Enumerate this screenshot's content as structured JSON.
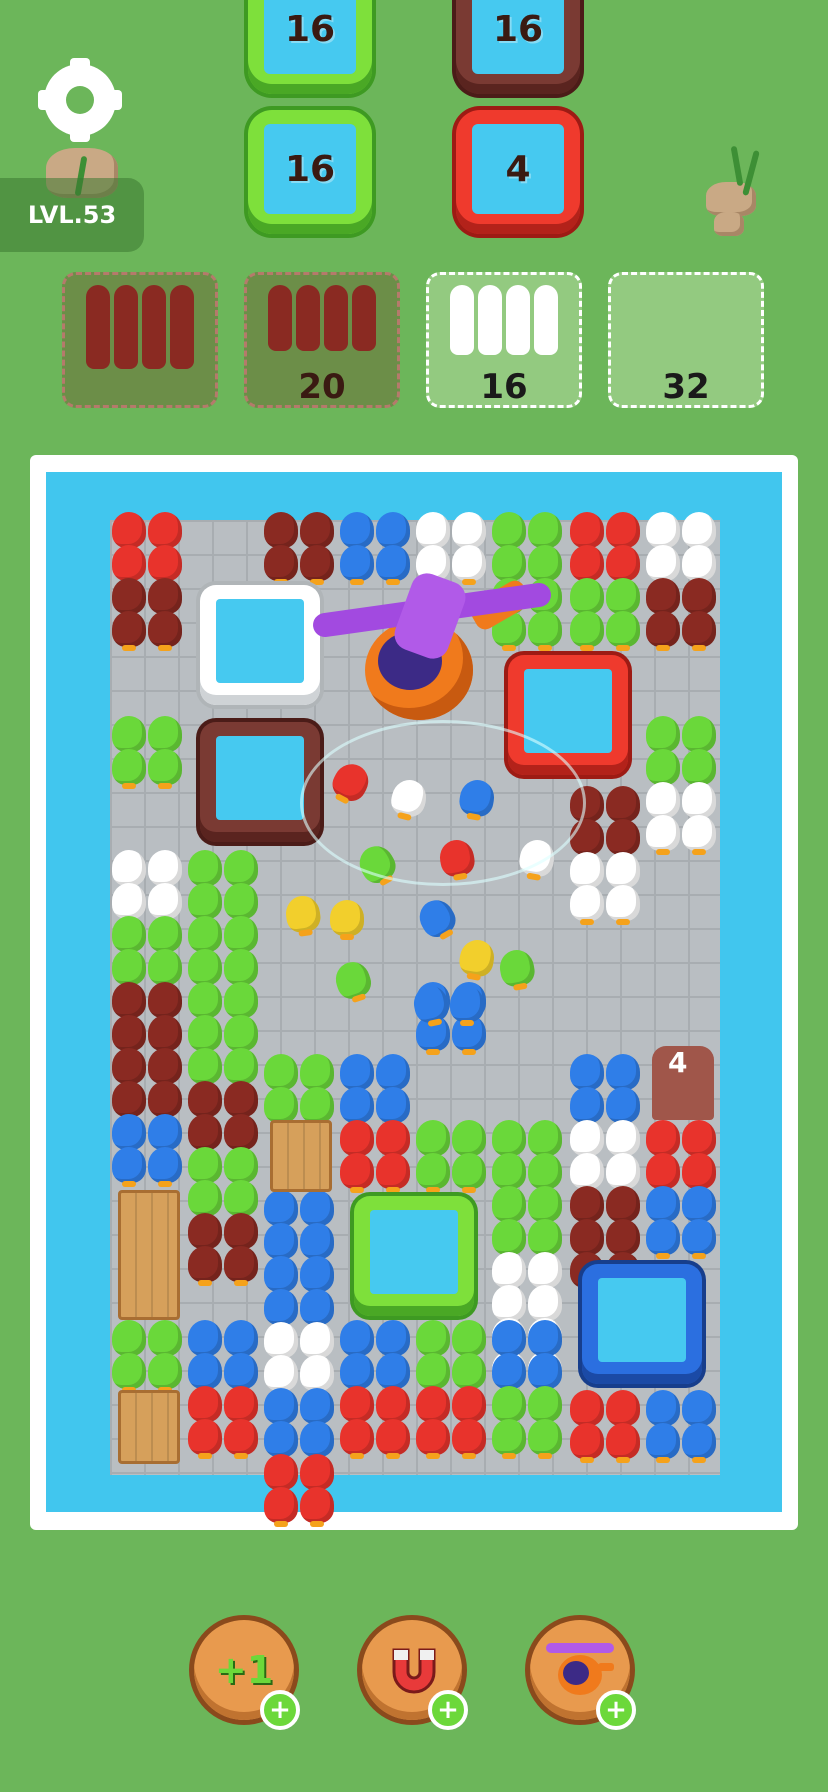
{
  "top_crates": [
    {
      "value": "16",
      "color": "green"
    },
    {
      "value": "16",
      "color": "green"
    },
    {
      "value": "16",
      "color": "maroon"
    },
    {
      "value": "4",
      "color": "red"
    }
  ],
  "level_label": "LVL.53",
  "slots": [
    {
      "count": "",
      "duck_color": "#8a2a22",
      "style": "filled-maroon"
    },
    {
      "count": "20",
      "duck_color": "#8a2a22",
      "style": "partial-maroon"
    },
    {
      "count": "16",
      "duck_color": "#ffffff",
      "style": "partial-white"
    },
    {
      "count": "32",
      "duck_color": "",
      "style": "empty"
    }
  ],
  "hut_count": "4",
  "boosters": [
    {
      "name": "add-slot",
      "label": "+1"
    },
    {
      "name": "magnet",
      "label": ""
    },
    {
      "name": "helicopter",
      "label": ""
    }
  ],
  "colors": {
    "background": "#6cb65a",
    "water": "#41c6ee",
    "green_crate": "#7ee03b",
    "maroon_crate": "#7a3a33",
    "red_crate": "#ef3a2d",
    "blue_crate": "#2b6fe0",
    "white_crate": "#ffffff"
  },
  "booster_plus": "+"
}
